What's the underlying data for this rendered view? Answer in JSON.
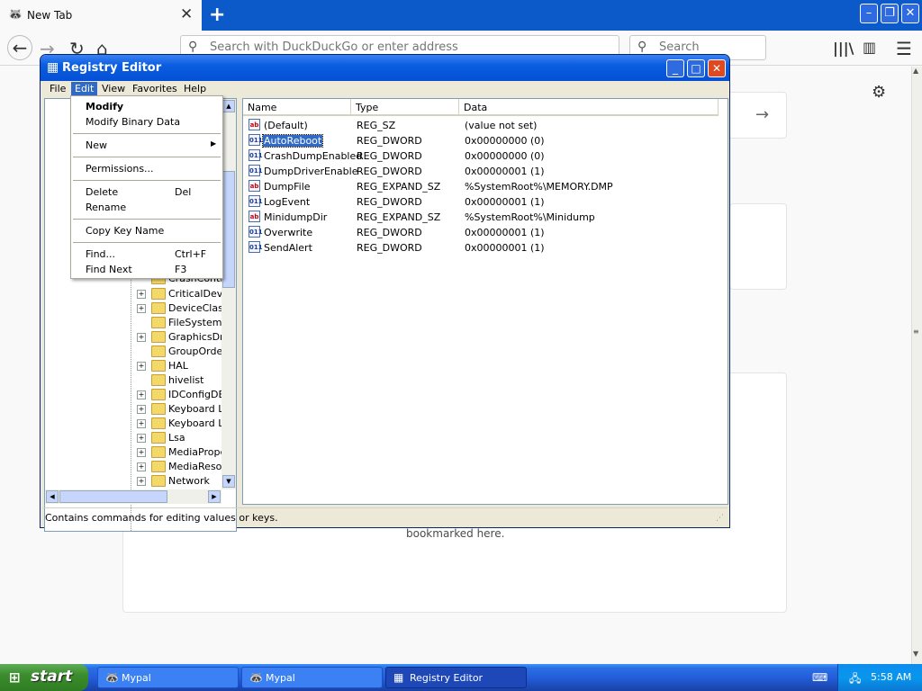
{
  "browser": {
    "tab_title": "New Tab",
    "address_placeholder": "Search with DuckDuckGo or enter address",
    "search_placeholder": "Search",
    "bookmark_text": "bookmarked here."
  },
  "regedit": {
    "title": "Registry Editor",
    "menus": [
      "File",
      "Edit",
      "View",
      "Favorites",
      "Help"
    ],
    "edit_menu": {
      "modify": "Modify",
      "modify_binary": "Modify Binary Data",
      "new": "New",
      "permissions": "Permissions...",
      "delete": "Delete",
      "delete_key": "Del",
      "rename": "Rename",
      "copy_key_name": "Copy Key Name",
      "find": "Find...",
      "find_key": "Ctrl+F",
      "find_next": "Find Next",
      "find_next_key": "F3"
    },
    "tree_items": [
      {
        "label": "CrashContr",
        "expandable": false
      },
      {
        "label": "CriticalDevic",
        "expandable": true
      },
      {
        "label": "DeviceClass",
        "expandable": true
      },
      {
        "label": "FileSystem",
        "expandable": false
      },
      {
        "label": "GraphicsDriv",
        "expandable": true
      },
      {
        "label": "GroupOrder",
        "expandable": false
      },
      {
        "label": "HAL",
        "expandable": true
      },
      {
        "label": "hivelist",
        "expandable": false
      },
      {
        "label": "IDConfigDB",
        "expandable": true
      },
      {
        "label": "Keyboard La",
        "expandable": true
      },
      {
        "label": "Keyboard La",
        "expandable": true
      },
      {
        "label": "Lsa",
        "expandable": true
      },
      {
        "label": "MediaProper",
        "expandable": true
      },
      {
        "label": "MediaResou",
        "expandable": true
      },
      {
        "label": "Network",
        "expandable": true
      }
    ],
    "columns": [
      "Name",
      "Type",
      "Data"
    ],
    "values": [
      {
        "name": "(Default)",
        "type": "REG_SZ",
        "data": "(value not set)",
        "icon": "ab"
      },
      {
        "name": "AutoReboot",
        "type": "REG_DWORD",
        "data": "0x00000000 (0)",
        "icon": "011"
      },
      {
        "name": "CrashDumpEnabled",
        "type": "REG_DWORD",
        "data": "0x00000000 (0)",
        "icon": "011"
      },
      {
        "name": "DumpDriverEnable",
        "type": "REG_DWORD",
        "data": "0x00000001 (1)",
        "icon": "011"
      },
      {
        "name": "DumpFile",
        "type": "REG_EXPAND_SZ",
        "data": "%SystemRoot%\\MEMORY.DMP",
        "icon": "ab"
      },
      {
        "name": "LogEvent",
        "type": "REG_DWORD",
        "data": "0x00000001 (1)",
        "icon": "011"
      },
      {
        "name": "MinidumpDir",
        "type": "REG_EXPAND_SZ",
        "data": "%SystemRoot%\\Minidump",
        "icon": "ab"
      },
      {
        "name": "Overwrite",
        "type": "REG_DWORD",
        "data": "0x00000001 (1)",
        "icon": "011"
      },
      {
        "name": "SendAlert",
        "type": "REG_DWORD",
        "data": "0x00000001 (1)",
        "icon": "011"
      }
    ],
    "status_text": "Contains commands for editing values or keys."
  },
  "taskbar": {
    "start_label": "start",
    "tasks": [
      {
        "label": "Mypal"
      },
      {
        "label": "Mypal"
      },
      {
        "label": "Registry Editor"
      }
    ],
    "clock": "5:58 AM"
  }
}
